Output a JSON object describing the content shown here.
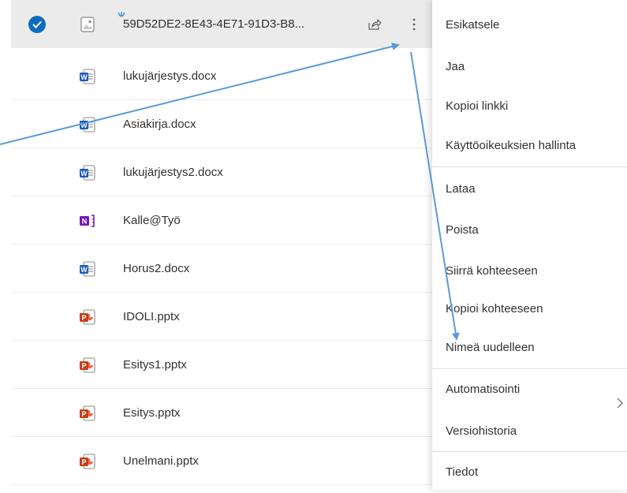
{
  "files": [
    {
      "name": "59D52DE2-8E43-4E71-91D3-B8...",
      "type": "image",
      "selected": true
    },
    {
      "name": "lukujärjestys.docx",
      "type": "word"
    },
    {
      "name": "Asiakirja.docx",
      "type": "word"
    },
    {
      "name": "lukujärjestys2.docx",
      "type": "word"
    },
    {
      "name": "Kalle@Työ",
      "type": "onenote"
    },
    {
      "name": "Horus2.docx",
      "type": "word"
    },
    {
      "name": "IDOLI.pptx",
      "type": "powerpoint"
    },
    {
      "name": "Esitys1.pptx",
      "type": "powerpoint"
    },
    {
      "name": "Esitys.pptx",
      "type": "powerpoint"
    },
    {
      "name": "Unelmani.pptx",
      "type": "powerpoint"
    }
  ],
  "context_menu": {
    "items": [
      {
        "label": "Esikatsele"
      },
      {
        "label": "Jaa"
      },
      {
        "label": "Kopioi linkki"
      },
      {
        "label": "Käyttöoikeuksien hallinta"
      },
      {
        "label": "Lataa"
      },
      {
        "label": "Poista"
      },
      {
        "label": "Siirrä kohteeseen"
      },
      {
        "label": "Kopioi kohteeseen"
      },
      {
        "label": "Nimeä uudelleen"
      },
      {
        "label": "Automatisointi",
        "has_submenu": true
      },
      {
        "label": "Versiohistoria"
      },
      {
        "label": "Tiedot"
      }
    ]
  },
  "colors": {
    "selected_row": "#ebebeb",
    "checkmark": "#0f6cbd",
    "annotation_arrow": "#5b9bd5",
    "word": "#185abd",
    "onenote": "#7719aa",
    "powerpoint": "#c43e1c"
  },
  "icons": {
    "check": "checkmark-circle-icon",
    "share": "share-icon",
    "more": "more-vertical-icon",
    "submenu": "chevron-right-icon"
  }
}
